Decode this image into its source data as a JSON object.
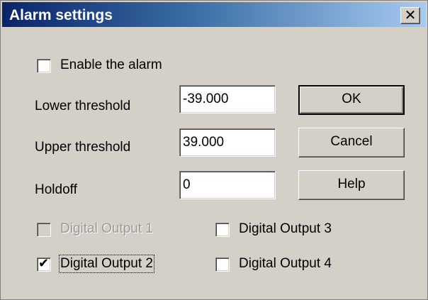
{
  "window": {
    "title": "Alarm settings",
    "close_glyph": "✕"
  },
  "enable_alarm": {
    "label": "Enable the alarm",
    "checked": false
  },
  "fields": {
    "lower": {
      "label": "Lower threshold",
      "value": "-39.000"
    },
    "upper": {
      "label": "Upper threshold",
      "value": "39.000"
    },
    "holdoff": {
      "label": "Holdoff",
      "value": "0"
    }
  },
  "buttons": {
    "ok": "OK",
    "cancel": "Cancel",
    "help": "Help"
  },
  "outputs": {
    "o1": {
      "label": "Digital Output 1",
      "checked": false,
      "enabled": false
    },
    "o2": {
      "label": "Digital Output 2",
      "checked": true,
      "enabled": true
    },
    "o3": {
      "label": "Digital Output 3",
      "checked": false,
      "enabled": true
    },
    "o4": {
      "label": "Digital Output 4",
      "checked": false,
      "enabled": true
    }
  },
  "check_glyph": "✔"
}
